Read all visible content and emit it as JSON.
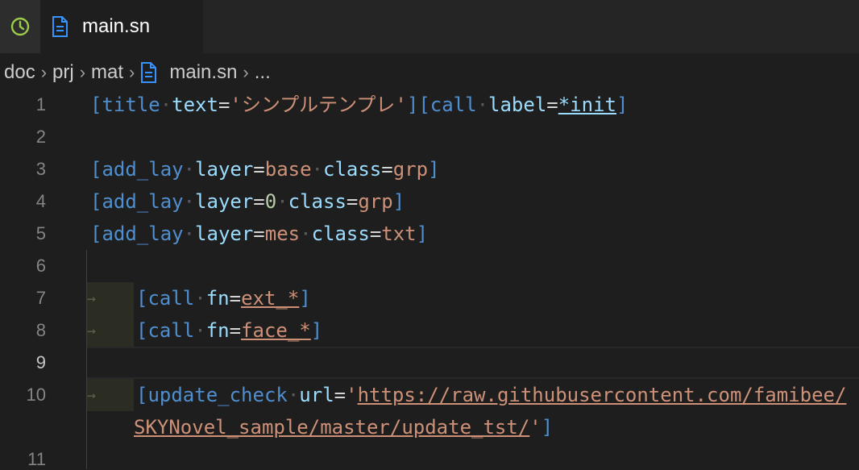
{
  "tabs": {
    "timeline_icon": "history-icon",
    "active": {
      "label": "main.sn",
      "icon": "file-icon"
    }
  },
  "breadcrumb": {
    "items": [
      "doc",
      "prj",
      "mat"
    ],
    "file": "main.sn",
    "more": "..."
  },
  "editor": {
    "line_numbers": [
      "1",
      "2",
      "3",
      "4",
      "5",
      "6",
      "7",
      "8",
      "9",
      "10",
      "11"
    ],
    "current_line": "9",
    "lines": {
      "l1": {
        "open": "[title",
        "attr1": "text",
        "eq1": "=",
        "str1": "'シンプルテンプレ'",
        "close1": "]",
        "open2": "[call",
        "attr2": "label",
        "eq2": "=",
        "val2": "*init",
        "close2": "]"
      },
      "l3": {
        "open": "[add_lay",
        "attr1": "layer",
        "eq1": "=",
        "val1": "base",
        "attr2": "class",
        "eq2": "=",
        "val2": "grp",
        "close": "]"
      },
      "l4": {
        "open": "[add_lay",
        "attr1": "layer",
        "eq1": "=",
        "val1": "0",
        "attr2": "class",
        "eq2": "=",
        "val2": "grp",
        "close": "]"
      },
      "l5": {
        "open": "[add_lay",
        "attr1": "layer",
        "eq1": "=",
        "val1": "mes",
        "attr2": "class",
        "eq2": "=",
        "val2": "txt",
        "close": "]"
      },
      "l7": {
        "open": "[call",
        "attr1": "fn",
        "eq1": "=",
        "val1": "ext_*",
        "close": "]"
      },
      "l8": {
        "open": "[call",
        "attr1": "fn",
        "eq1": "=",
        "val1": "face_*",
        "close": "]"
      },
      "l10": {
        "open": "[update_check",
        "attr1": "url",
        "eq1": "=",
        "q1": "'",
        "url_part1": "https://raw.githubusercontent.com/famibee/",
        "url_part2": "SKYNovel_sample/master/update_tst/",
        "q2": "'",
        "close": "]"
      }
    }
  },
  "colors": {
    "background": "#1e1e1e",
    "tag": "#569cd6",
    "attribute": "#9cdcfe",
    "string": "#ce9178",
    "number": "#b5cea8"
  }
}
